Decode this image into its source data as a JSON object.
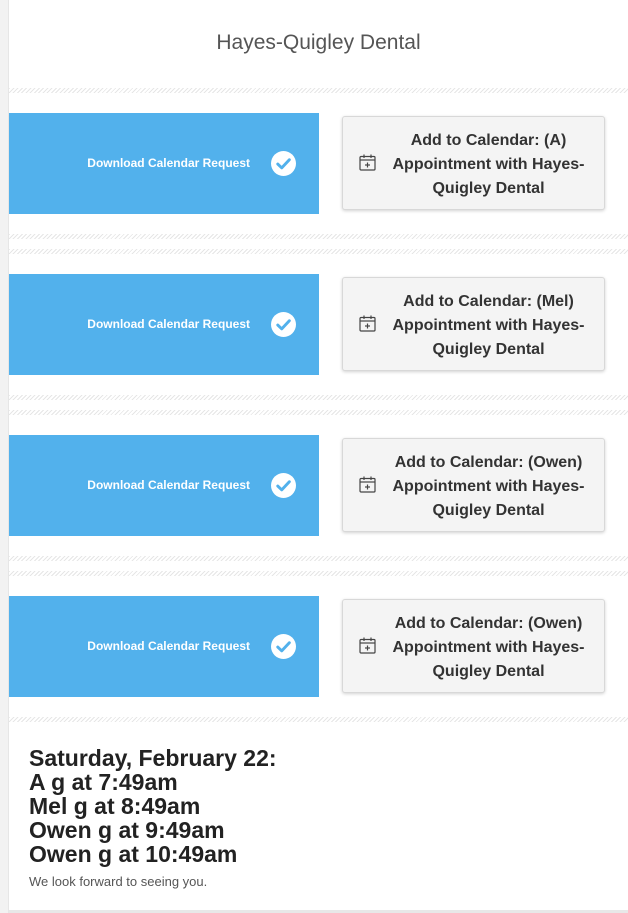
{
  "header": {
    "title": "Hayes-Quigley Dental"
  },
  "appointments": [
    {
      "download_label": "Download Calendar Request",
      "calendar_label": "Add to Calendar: (A) Appointment with Hayes-Quigley Dental"
    },
    {
      "download_label": "Download Calendar Request",
      "calendar_label": "Add to Calendar: (Mel) Appointment with Hayes-Quigley Dental"
    },
    {
      "download_label": "Download Calendar Request",
      "calendar_label": "Add to Calendar: (Owen) Appointment with Hayes-Quigley Dental"
    },
    {
      "download_label": "Download Calendar Request",
      "calendar_label": "Add to Calendar: (Owen) Appointment with Hayes-Quigley Dental"
    }
  ],
  "summary": {
    "date_heading": "Saturday, February 22:",
    "lines": [
      "A g at 7:49am",
      "Mel g at 8:49am",
      "Owen g at 9:49am",
      "Owen g at 10:49am"
    ],
    "closing": "We look forward to seeing you."
  },
  "icons": {
    "download": "check-circle-icon",
    "calendar": "calendar-plus-icon"
  },
  "colors": {
    "download_button": "#52b1ec",
    "calendar_card": "#f4f4f4",
    "heading_text": "#222222"
  }
}
